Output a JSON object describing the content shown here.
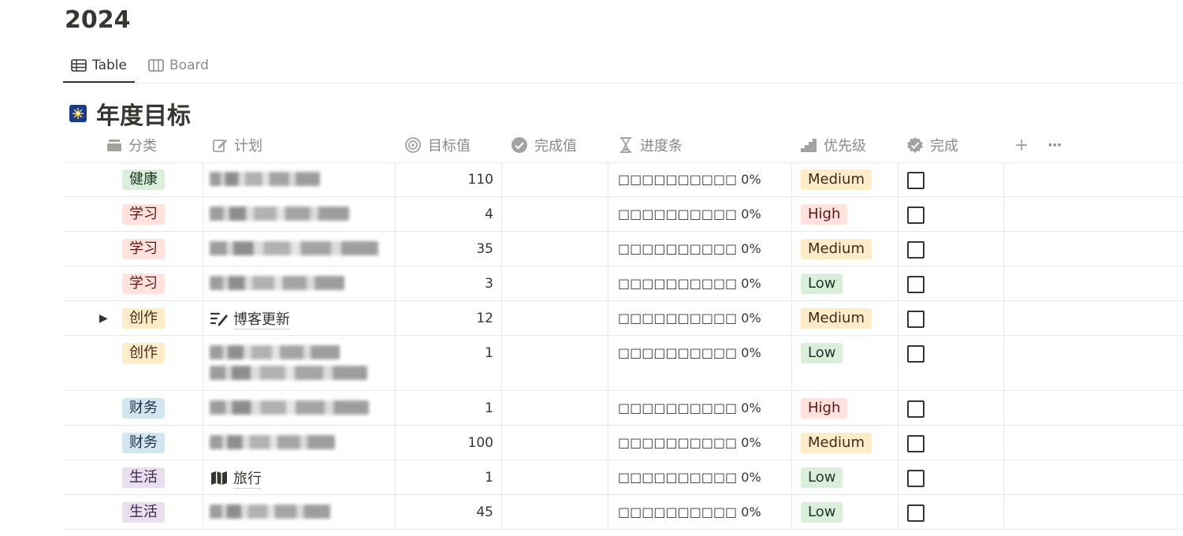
{
  "page": {
    "title": "2024"
  },
  "views": {
    "tabs": [
      {
        "label": "Table",
        "icon": "table-icon",
        "active": true
      },
      {
        "label": "Board",
        "icon": "board-icon",
        "active": false
      }
    ]
  },
  "database": {
    "icon": "fireworks-emoji-icon",
    "title": "年度目标"
  },
  "columns": {
    "category": "分类",
    "plan": "计划",
    "target": "目标值",
    "done_value": "完成值",
    "progress": "进度条",
    "priority": "优先级",
    "complete": "完成",
    "add": "+",
    "more": "···"
  },
  "colors": {
    "健康": {
      "bg": "#dbeddb",
      "fg": "#1c3829"
    },
    "学习": {
      "bg": "#ffe2dd",
      "fg": "#5d1715"
    },
    "创作": {
      "bg": "#fdecc8",
      "fg": "#402c1b"
    },
    "财务": {
      "bg": "#d3e5ef",
      "fg": "#183347"
    },
    "生活": {
      "bg": "#e8deee",
      "fg": "#412454"
    },
    "High": {
      "bg": "#ffe2dd",
      "fg": "#5d1715"
    },
    "Medium": {
      "bg": "#fdecc8",
      "fg": "#402c1b"
    },
    "Low": {
      "bg": "#dbeddb",
      "fg": "#1c3829"
    }
  },
  "rows": [
    {
      "category": "健康",
      "plan": "",
      "plan_icon": "",
      "blurred": true,
      "target": "110",
      "progress": "□□□□□□□□□□ 0%",
      "priority": "Medium",
      "checked": false,
      "toggle": false
    },
    {
      "category": "学习",
      "plan": "",
      "plan_icon": "",
      "blurred": true,
      "target": "4",
      "progress": "□□□□□□□□□□ 0%",
      "priority": "High",
      "checked": false,
      "toggle": false
    },
    {
      "category": "学习",
      "plan": "",
      "plan_icon": "",
      "blurred": true,
      "target": "35",
      "progress": "□□□□□□□□□□ 0%",
      "priority": "Medium",
      "checked": false,
      "toggle": false
    },
    {
      "category": "学习",
      "plan": "",
      "plan_icon": "",
      "blurred": true,
      "target": "3",
      "progress": "□□□□□□□□□□ 0%",
      "priority": "Low",
      "checked": false,
      "toggle": false
    },
    {
      "category": "创作",
      "plan": "博客更新",
      "plan_icon": "compose-icon",
      "blurred": false,
      "target": "12",
      "progress": "□□□□□□□□□□ 0%",
      "priority": "Medium",
      "checked": false,
      "toggle": true
    },
    {
      "category": "创作",
      "plan": "",
      "plan_icon": "",
      "blurred": true,
      "target": "1",
      "progress": "□□□□□□□□□□ 0%",
      "priority": "Low",
      "checked": false,
      "toggle": false,
      "tall": true
    },
    {
      "category": "财务",
      "plan": "",
      "plan_icon": "",
      "blurred": true,
      "target": "1",
      "progress": "□□□□□□□□□□ 0%",
      "priority": "High",
      "checked": false,
      "toggle": false
    },
    {
      "category": "财务",
      "plan": "",
      "plan_icon": "",
      "blurred": true,
      "target": "100",
      "progress": "□□□□□□□□□□ 0%",
      "priority": "Medium",
      "checked": false,
      "toggle": false
    },
    {
      "category": "生活",
      "plan": "旅行",
      "plan_icon": "map-icon",
      "blurred": false,
      "target": "1",
      "progress": "□□□□□□□□□□ 0%",
      "priority": "Low",
      "checked": false,
      "toggle": false
    },
    {
      "category": "生活",
      "plan": "",
      "plan_icon": "",
      "blurred": true,
      "target": "45",
      "progress": "□□□□□□□□□□ 0%",
      "priority": "Low",
      "checked": false,
      "toggle": false
    }
  ],
  "toggle_glyph": "▶"
}
